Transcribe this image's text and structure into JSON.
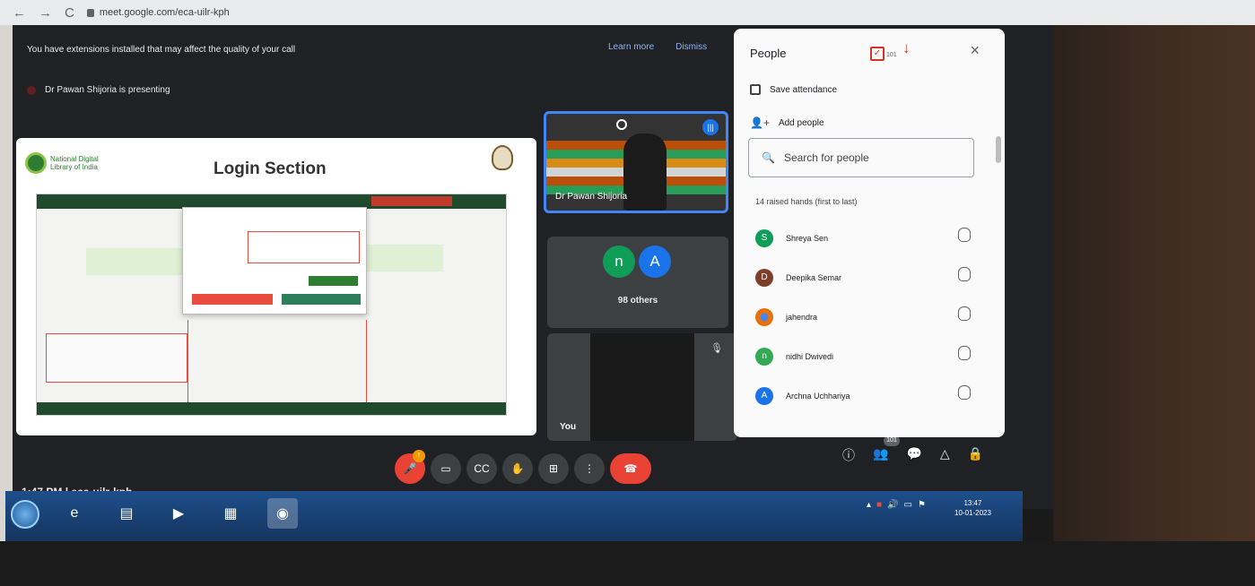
{
  "browser": {
    "url": "meet.google.com/eca-uilr-kph"
  },
  "notice": {
    "text": "You have extensions installed that may affect the quality of your call",
    "learn_more": "Learn more",
    "dismiss": "Dismiss"
  },
  "presenting": "Dr Pawan Shijoria is presenting",
  "slide": {
    "title": "Login Section",
    "org": "National Digital Library of India"
  },
  "tiles": {
    "speaker_name": "Dr Pawan Shijoria",
    "others_avatars": [
      "n",
      "A"
    ],
    "others_label": "98 others",
    "self_label": "You"
  },
  "people_panel": {
    "title": "People",
    "tray_count": "101",
    "save_attendance": "Save attendance",
    "add_people": "Add people",
    "search_placeholder": "Search for people",
    "raised_hands_label": "14 raised hands (first to last)",
    "people": [
      {
        "initial": "S",
        "name": "Shreya Sen",
        "color": "#0f9d58"
      },
      {
        "initial": "D",
        "name": "Deepika Semar",
        "color": "#7b3f2a"
      },
      {
        "initial": "",
        "name": "jahendra",
        "color": "#e8710a"
      },
      {
        "initial": "n",
        "name": "nidhi Dwivedi",
        "color": "#34a853"
      },
      {
        "initial": "A",
        "name": "Archna Uchhariya",
        "color": "#1a73e8"
      }
    ]
  },
  "meeting_code_bar": {
    "time": "1:47 PM",
    "code": "eca-uilr-kph"
  },
  "taskbar": {
    "clock_time": "13:47",
    "clock_date": "10-01-2023"
  }
}
